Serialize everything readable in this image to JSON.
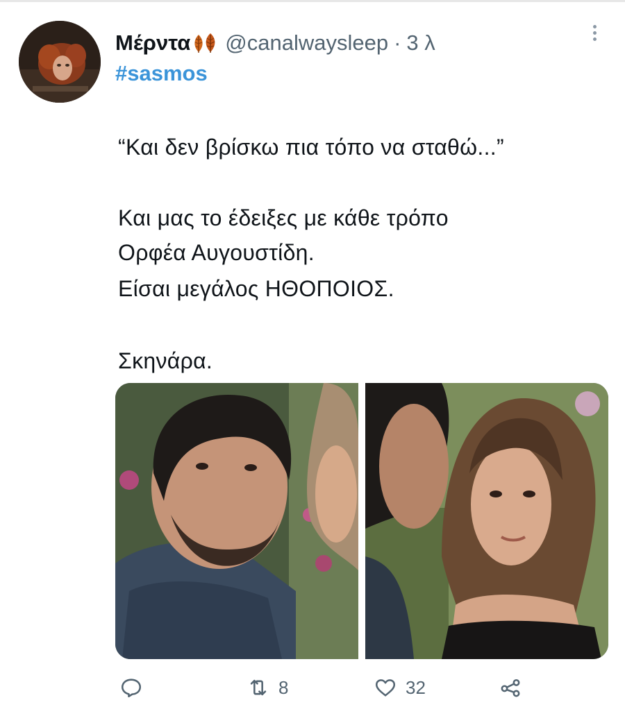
{
  "tweet": {
    "author_name": "Μέρντα",
    "author_handle": "@canalwaysleep",
    "separator": "·",
    "time_ago": "3 λ",
    "hashtag": "#sasmos",
    "lines": [
      "“Και δεν βρίσκω πια τόπο να σταθώ...”",
      "Και μας το έδειξες με κάθε τρόπο",
      "Ορφέα Αυγουστίδη.",
      "Είσαι μεγάλος ΗΘΟΠΟΙΟΣ.",
      "Σκηνάρα."
    ]
  },
  "actions": {
    "reply_icon": "reply-icon",
    "retweet_icon": "retweet-icon",
    "retweet_count": "8",
    "like_icon": "heart-icon",
    "like_count": "32",
    "share_icon": "share-icon"
  },
  "colors": {
    "hashtag": "#3b94d9",
    "secondary_text": "#536471",
    "leaf_emoji": "#d2691e"
  }
}
